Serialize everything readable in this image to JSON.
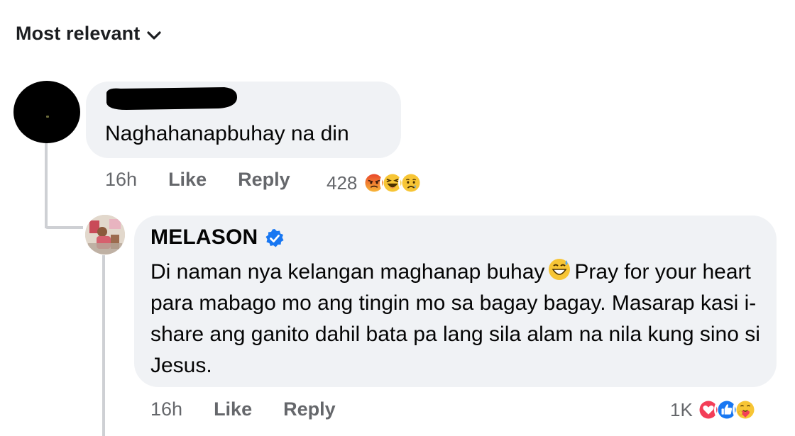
{
  "sort": {
    "label": "Most relevant",
    "icon": "chevron-down-icon"
  },
  "comments": [
    {
      "author_redacted": true,
      "text": "Naghahanapbuhay na din",
      "time": "16h",
      "like_label": "Like",
      "reply_label": "Reply",
      "reaction_count": "428",
      "reactions": [
        "angry-reaction-icon",
        "haha-reaction-icon",
        "sad-reaction-icon"
      ]
    },
    {
      "author": "MELASON",
      "verified": true,
      "text_part1": "Di naman nya kelangan maghanap buhay",
      "inline_emoji": "grinning-sweat-emoji-icon",
      "text_part2": "Pray for your heart para mabago mo ang tingin mo sa bagay bagay. Masarap kasi i-share ang ganito dahil bata pa lang sila alam na nila kung sino si Jesus.",
      "time": "16h",
      "like_label": "Like",
      "reply_label": "Reply",
      "reaction_count": "1K",
      "reactions": [
        "love-reaction-icon",
        "like-reaction-icon",
        "care-reaction-icon"
      ]
    }
  ],
  "colors": {
    "bubble": "#f0f2f5",
    "meta_text": "#65676b",
    "verified": "#1877f2",
    "thread_line": "#ced0d4"
  }
}
